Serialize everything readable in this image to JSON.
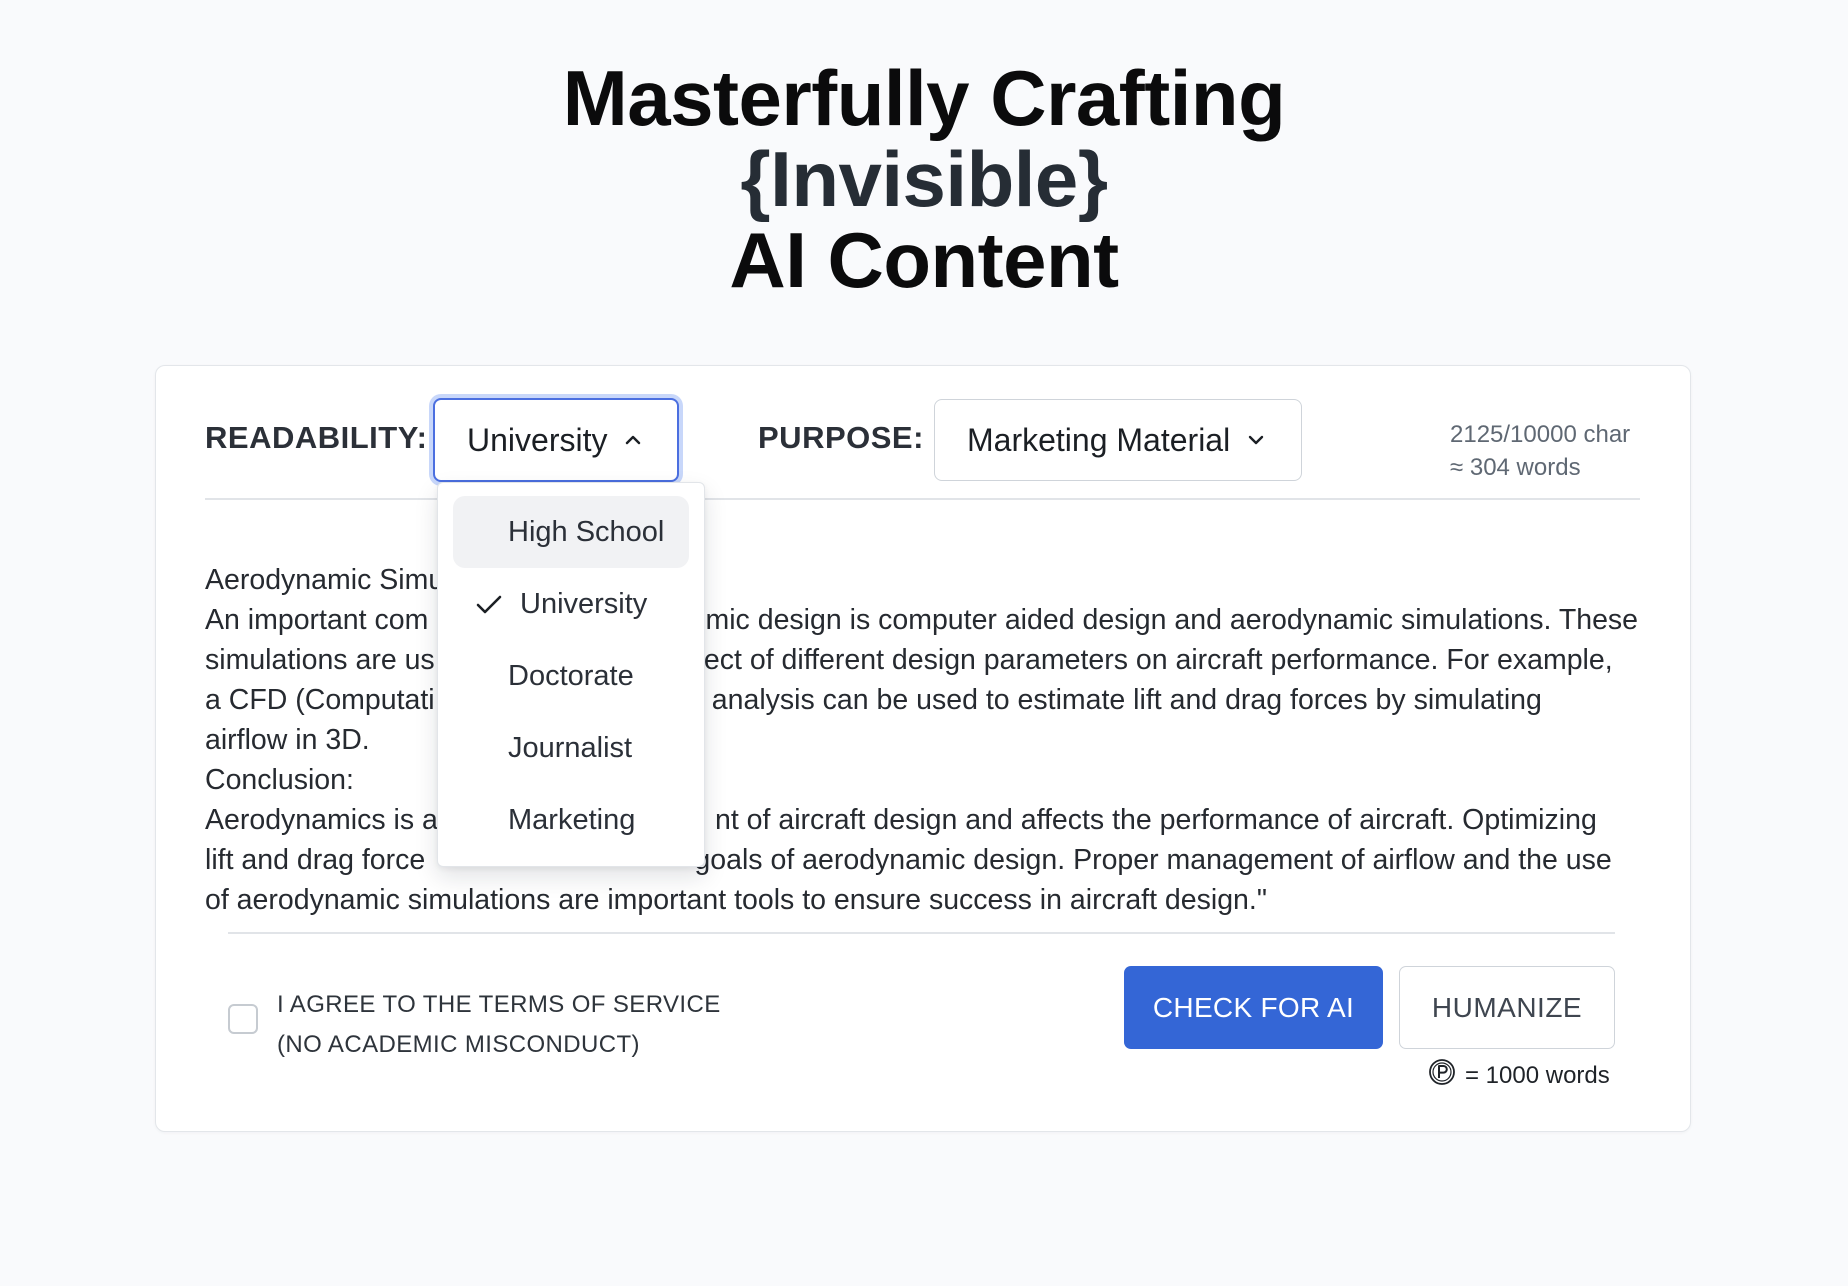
{
  "header": {
    "line1": "Masterfully Crafting",
    "line2": "{Invisible}",
    "line3": "AI Content"
  },
  "controls": {
    "readability_label": "READABILITY:",
    "readability_value": "University",
    "purpose_label": "PURPOSE:",
    "purpose_value": "Marketing Material",
    "char_count": "2125/10000 char",
    "word_estimate": "≈ 304 words"
  },
  "readability_menu": {
    "items": [
      {
        "label": "High School",
        "checked": false,
        "highlighted": true
      },
      {
        "label": "University",
        "checked": true,
        "highlighted": false
      },
      {
        "label": "Doctorate",
        "checked": false,
        "highlighted": false
      },
      {
        "label": "Journalist",
        "checked": false,
        "highlighted": false
      },
      {
        "label": "Marketing",
        "checked": false,
        "highlighted": false
      }
    ]
  },
  "content": {
    "lines": [
      "Aerodynamic Simu",
      "An important com                                   mic design is computer aided design and aerodynamic simulations. These",
      "simulations are us                                  ect of different design parameters on aircraft performance. For example,",
      "a CFD (Computati                                   analysis can be used to estimate lift and drag forces by simulating",
      "airflow in 3D.",
      "Conclusion:",
      "Aerodynamics is a                                   nt of aircraft design and affects the performance of aircraft. Optimizing",
      "lift and drag force                                  goals of aerodynamic design. Proper management of airflow and the use",
      "of aerodynamic simulations are important tools to ensure success in aircraft design.\""
    ]
  },
  "footer": {
    "terms_line1": "I AGREE TO THE TERMS OF SERVICE",
    "terms_line2": "(NO ACADEMIC MISCONDUCT)",
    "terms_checked": false,
    "check_button": "CHECK FOR AI",
    "humanize_button": "HUMANIZE",
    "credit_note": "= 1000 words",
    "credit_icon": "p-coin-icon"
  },
  "colors": {
    "primary": "#3466d6",
    "focus_ring": "#4b6fe0",
    "background": "#f9fafc"
  }
}
